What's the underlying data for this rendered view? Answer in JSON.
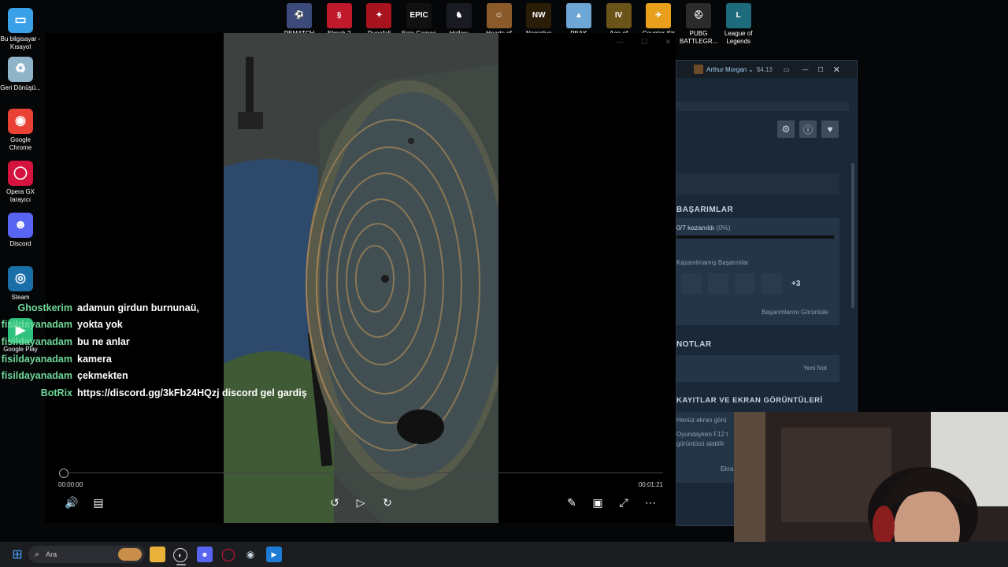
{
  "desktop_icons": [
    {
      "label": "Bu bilgisayar - Kısayol",
      "icon": "monitor-icon",
      "color": "#3aa0e8"
    },
    {
      "label": "Geri Dönüşü...",
      "icon": "recycle-bin-icon",
      "color": "#8fb3c9"
    },
    {
      "label": "Google Chrome",
      "icon": "chrome-icon",
      "color": "#e94235"
    },
    {
      "label": "Opera GX tarayıcı",
      "icon": "opera-gx-icon",
      "color": "#d4143f"
    },
    {
      "label": "Discord",
      "icon": "discord-icon",
      "color": "#5865f2"
    },
    {
      "label": "Steam",
      "icon": "steam-icon",
      "color": "#1b6fa8"
    },
    {
      "label": "Google Play",
      "icon": "google-play-icon",
      "color": "#2ec27e"
    }
  ],
  "game_icons": [
    {
      "label": "PEMATCH",
      "icon": "pes-icon",
      "color": "#3b4a7a"
    },
    {
      "label": "Elmah 2",
      "icon": "elma-icon",
      "color": "#c0192b"
    },
    {
      "label": "Runefall",
      "icon": "runefall-icon",
      "color": "#a8141e"
    },
    {
      "label": "Epic Games",
      "icon": "epic-games-icon",
      "color": "#111111"
    },
    {
      "label": "Hollow",
      "icon": "hollow-knight-icon",
      "color": "#1a1a22"
    },
    {
      "label": "Hearts of Iron",
      "icon": "hoi-icon",
      "color": "#8a5a2a"
    },
    {
      "label": "Narrative",
      "icon": "nw-icon",
      "color": "#2a1d08"
    },
    {
      "label": "PEAK",
      "icon": "peak-icon",
      "color": "#6ea6d6"
    },
    {
      "label": "Age of",
      "icon": "age-of-empires-icon",
      "color": "#6b5418"
    },
    {
      "label": "Counter-Str",
      "icon": "counter-strike-icon",
      "color": "#e8a01c"
    },
    {
      "label": "PUBG BATTLEGR...",
      "icon": "pubg-icon",
      "color": "#2b2b2b"
    },
    {
      "label": "League of Legends",
      "icon": "league-of-legends-icon",
      "color": "#1d6b7a"
    }
  ],
  "game_glyphs": [
    "⚽",
    "§",
    "✦",
    "EPIC",
    "♞",
    "☺",
    "NW",
    "▲",
    "IV",
    "✈",
    "⛑",
    "L"
  ],
  "steam": {
    "user_name": "Arthur Morgan",
    "balance": "$4.13",
    "achievements_title": "BAŞARIMLAR",
    "achievements_progress": "0/7 kazanıldı",
    "achievements_percent": "(0%)",
    "unearned_label": "Kazanılmamış Başarımlar",
    "more_count": "+3",
    "view_achievements": "Başarımlarını Görüntüle",
    "notes_title": "NOTLAR",
    "new_note": "Yeni Not",
    "screenshots_title": "KAYITLAR VE EKRAN GÖRÜNTÜLERİ",
    "screenshots_line1": "Henüz ekran görü",
    "screenshots_line2": "Oyundayken F12 t",
    "screenshots_line3": "görüntüsü alabilir",
    "screenshots_link": "Ekra"
  },
  "player": {
    "time_current": "00:00:00",
    "time_total": "00:01:21",
    "progress": 0.0
  },
  "chat": [
    {
      "user": "Ghostkerim",
      "color": "#6fd99a",
      "message": "adamun girdun burnunaü,"
    },
    {
      "user": "fisildayanadam",
      "color": "#6fd99a",
      "message": "yokta yok"
    },
    {
      "user": "fisildayanadam",
      "color": "#6fd99a",
      "message": "bu ne anlar"
    },
    {
      "user": "fisildayanadam",
      "color": "#6fd99a",
      "message": "kamera"
    },
    {
      "user": "fisildayanadam",
      "color": "#6fd99a",
      "message": "çekmekten"
    },
    {
      "user": "BotRix",
      "color": "#6fd99a",
      "message": "https://discord.gg/3kFb24HQzj discord gel gardiş"
    }
  ],
  "taskbar": {
    "search_placeholder": "Ara"
  }
}
